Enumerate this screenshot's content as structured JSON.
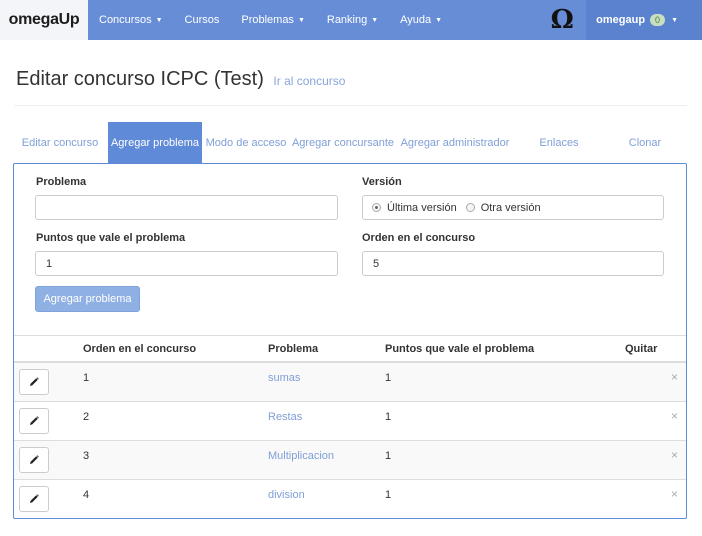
{
  "navbar": {
    "brand_omega": "omega",
    "brand_up": "Up",
    "items": [
      {
        "label": "Concursos",
        "caret": true
      },
      {
        "label": "Cursos",
        "caret": false
      },
      {
        "label": "Problemas",
        "caret": true
      },
      {
        "label": "Ranking",
        "caret": true
      },
      {
        "label": "Ayuda",
        "caret": true
      }
    ],
    "omega_symbol": "Ω",
    "username": "omegaup",
    "notifications": "0"
  },
  "page": {
    "title": "Editar concurso ICPC (Test)",
    "title_link": "Ir al concurso"
  },
  "tabs": [
    {
      "label": "Editar concurso",
      "active": false
    },
    {
      "label": "Agregar problema",
      "active": true
    },
    {
      "label": "Modo de acceso",
      "active": false
    },
    {
      "label": "Agregar concursante",
      "active": false
    },
    {
      "label": "Agregar administrador",
      "active": false
    },
    {
      "label": "Enlaces",
      "active": false
    },
    {
      "label": "Clonar",
      "active": false
    }
  ],
  "form": {
    "problem_label": "Problema",
    "problem_value": "",
    "version_label": "Versión",
    "version_options": [
      {
        "label": "Última versión",
        "checked": true
      },
      {
        "label": "Otra versión",
        "checked": false
      }
    ],
    "points_label": "Puntos que vale el problema",
    "points_value": "1",
    "order_label": "Orden en el concurso",
    "order_value": "5",
    "submit_label": "Agregar problema"
  },
  "table": {
    "headers": {
      "order": "Orden en el concurso",
      "problem": "Problema",
      "points": "Puntos que vale el problema",
      "remove": "Quitar"
    },
    "rows": [
      {
        "order": "1",
        "problem": "sumas",
        "points": "1"
      },
      {
        "order": "2",
        "problem": "Restas",
        "points": "1"
      },
      {
        "order": "3",
        "problem": "Multiplicacion",
        "points": "1"
      },
      {
        "order": "4",
        "problem": "division",
        "points": "1"
      }
    ],
    "remove_glyph": "×"
  },
  "colors": {
    "navbar": "#678dd7",
    "accent": "#5f8ad7",
    "link": "#7f9fd6"
  }
}
